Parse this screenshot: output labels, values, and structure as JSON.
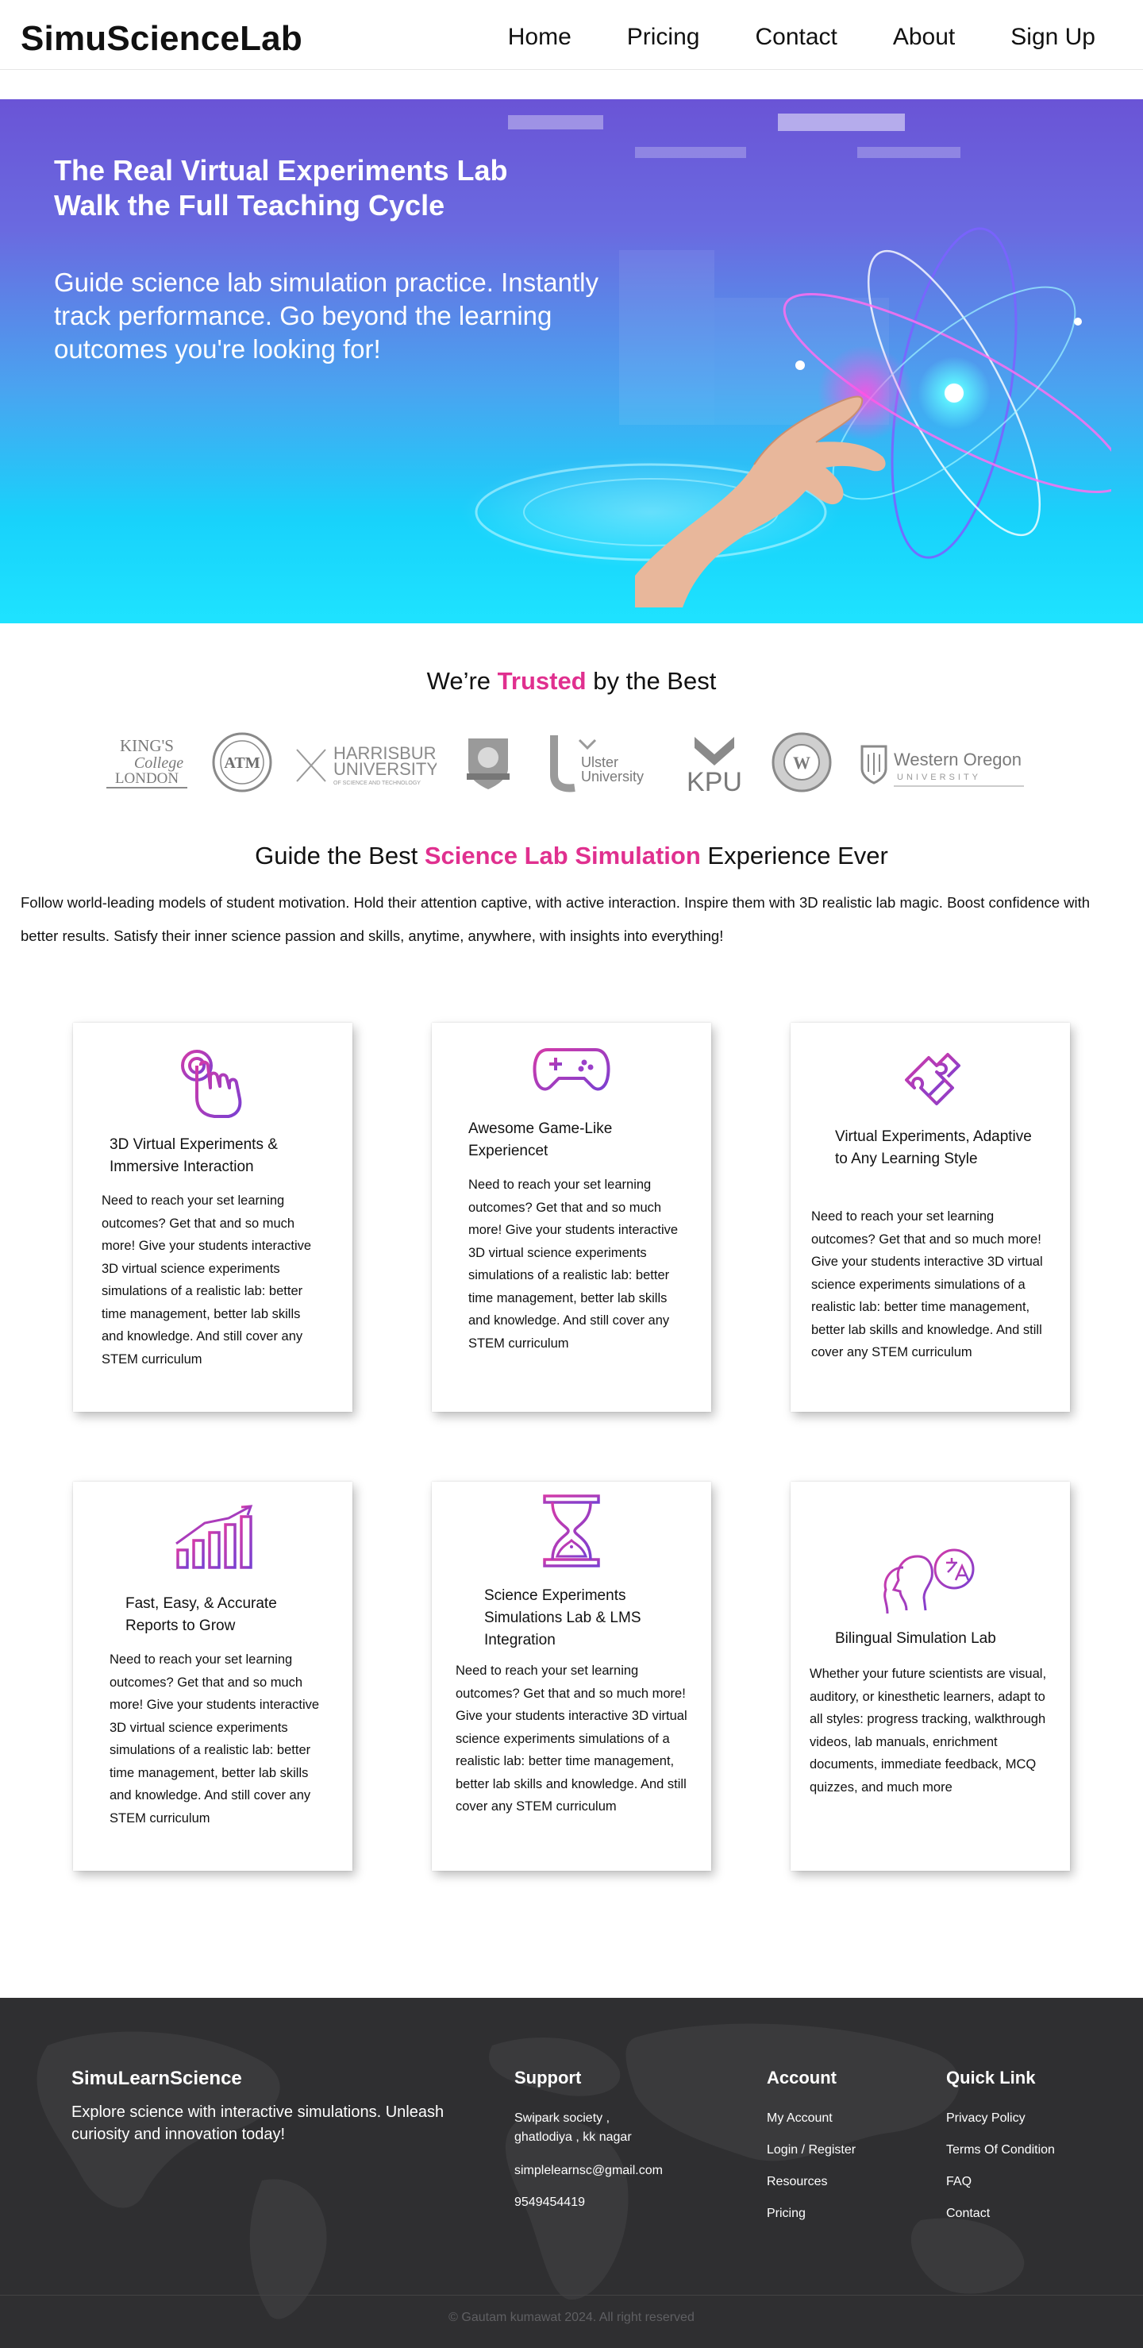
{
  "header": {
    "brand": "SimuScienceLab",
    "nav": [
      "Home",
      "Pricing",
      "Contact",
      "About",
      "Sign Up"
    ]
  },
  "hero": {
    "title_line1": "The Real Virtual Experiments Lab",
    "title_line2": "Walk the Full Teaching Cycle",
    "subtitle": "Guide science lab simulation practice. Instantly track performance. Go beyond the learning outcomes you're looking for!"
  },
  "trusted": {
    "prefix": "We’re ",
    "highlight": "Trusted",
    "suffix": " by the Best",
    "logos": [
      {
        "name": "King's College London",
        "lines": [
          "KING'S",
          "College",
          "LONDON"
        ]
      },
      {
        "name": "Texas A&M seal",
        "lines": [
          "ATM"
        ]
      },
      {
        "name": "Harrisburg University",
        "lines": [
          "HARRISBURG",
          "UNIVERSITY",
          "OF SCIENCE AND TECHNOLOGY"
        ]
      },
      {
        "name": "University crest",
        "lines": []
      },
      {
        "name": "Ulster University",
        "lines": [
          "Ulster",
          "University"
        ]
      },
      {
        "name": "KPU",
        "lines": [
          "KPU"
        ]
      },
      {
        "name": "College seal W",
        "lines": [
          "W"
        ]
      },
      {
        "name": "Western Oregon University",
        "lines": [
          "Western Oregon",
          "UNIVERSITY"
        ]
      }
    ]
  },
  "guide": {
    "prefix": "Guide the Best ",
    "highlight": "Science Lab Simulation",
    "suffix": " Experience Ever",
    "text": "Follow world-leading models of student motivation. Hold their attention captive, with active interaction. Inspire them with 3D realistic lab magic. Boost confidence with better results. Satisfy their inner science passion and skills, anytime, anywhere, with insights into everything!"
  },
  "cards": [
    {
      "icon": "touch-hand-icon",
      "title": "3D Virtual Experiments & Immersive Interaction",
      "body": "Need to reach your set learning outcomes? Get that and so much more! Give your students interactive 3D virtual science experiments simulations of a realistic lab: better time management, better lab skills and knowledge. And still cover any STEM curriculum"
    },
    {
      "icon": "gamepad-icon",
      "title": "Awesome Game-Like Experiencet",
      "body": "Need to reach your set learning outcomes? Get that and so much more! Give your students interactive 3D virtual science experiments simulations of a realistic lab: better time management, better lab skills and knowledge. And still cover any STEM curriculum"
    },
    {
      "icon": "puzzle-icon",
      "title": "Virtual Experiments, Adaptive to Any Learning Style",
      "body": "Need to reach your set learning outcomes? Get that and so much more! Give your students interactive 3D virtual science experiments simulations of a realistic lab: better time management, better lab skills and knowledge. And still cover any STEM curriculum"
    },
    {
      "icon": "growth-chart-icon",
      "title": "Fast, Easy, & Accurate Reports to Grow",
      "body": "Need to reach your set learning outcomes? Get that and so much more! Give your students interactive 3D virtual science experiments simulations of a realistic lab: better time management, better lab skills and knowledge. And still cover any STEM curriculum"
    },
    {
      "icon": "hourglass-icon",
      "title": "Science Experiments Simulations Lab & LMS Integration",
      "body": "Need to reach your set learning outcomes? Get that and so much more! Give your students interactive 3D virtual science experiments simulations of a realistic lab: better time management, better lab skills and knowledge. And still cover any STEM curriculum"
    },
    {
      "icon": "bilingual-icon",
      "title": "Bilingual Simulation Lab",
      "body": "Whether your future scientists are visual, auditory, or kinesthetic learners, adapt to all styles: progress tracking, walkthrough videos, lab manuals, enrichment documents, immediate feedback, MCQ quizzes, and much more"
    }
  ],
  "footer": {
    "brand": "SimuLearnScience",
    "tagline": "Explore science with interactive simulations. Unleash curiosity and innovation today!",
    "support": {
      "title": "Support",
      "address_line1": "Swipark society ,",
      "address_line2": "ghatlodiya , kk nagar",
      "email": "simplelearnsc@gmail.com",
      "phone": "9549454419"
    },
    "account": {
      "title": "Account",
      "items": [
        "My Account",
        "Login / Register",
        "Resources",
        "Pricing"
      ]
    },
    "quick": {
      "title": "Quick Link",
      "items": [
        "Privacy Policy",
        "Terms Of Condition",
        "FAQ",
        "Contact"
      ]
    },
    "copyright": "Gautam kumawat 2024. All right reserved"
  },
  "colors": {
    "accent": "#e0308f",
    "icon_gradient_start": "#c43ab8",
    "icon_gradient_end": "#7a3fd1",
    "footer_bg": "#2f2f31"
  }
}
